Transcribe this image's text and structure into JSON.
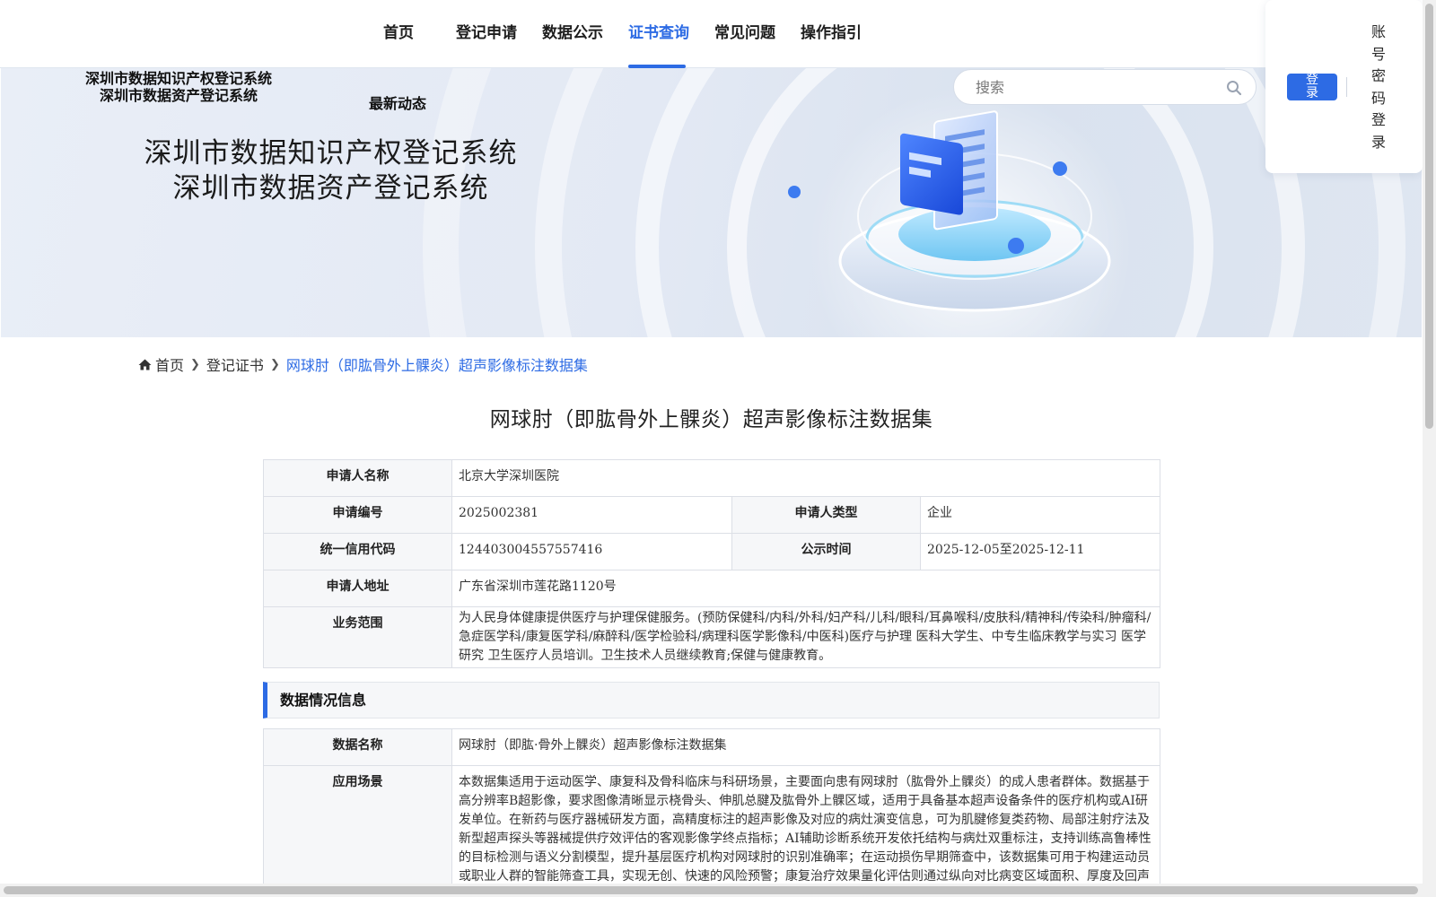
{
  "nav": {
    "items": [
      {
        "label": "首页",
        "active": false
      },
      {
        "label": "登记申请",
        "active": false
      },
      {
        "label": "数据公示",
        "active": false
      },
      {
        "label": "证书查询",
        "active": true
      },
      {
        "label": "常见问题",
        "active": false
      },
      {
        "label": "操作指引",
        "active": false
      }
    ]
  },
  "header": {
    "logo_line1": "深圳市数据知识产权登记系统",
    "logo_line2": "深圳市数据资产登记系统",
    "news_label": "最新动态",
    "banner_title_line1": "深圳市数据知识产权登记系统",
    "banner_title_line2": "深圳市数据资产登记系统"
  },
  "search": {
    "placeholder": "搜索",
    "icon": "search-icon"
  },
  "login": {
    "button_label": "登录",
    "password_login_label": "账号密码登录"
  },
  "breadcrumb": {
    "home": "首页",
    "level2": "登记证书",
    "current": "网球肘（即肱骨外上髁炎）超声影像标注数据集",
    "icon": "home-icon"
  },
  "page": {
    "title": "网球肘（即肱骨外上髁炎）超声影像标注数据集"
  },
  "applicant": {
    "name_label": "申请人名称",
    "name_value": "北京大学深圳医院",
    "number_label": "申请编号",
    "number_value": "2025002381",
    "type_label": "申请人类型",
    "type_value": "企业",
    "credit_label": "统一信用代码",
    "credit_value": "12440300455755741б",
    "publicity_label": "公示时间",
    "publicity_value": "2025-12-05至2025-12-11",
    "address_label": "申请人地址",
    "address_value": "广东省深圳市莲花路1120号",
    "scope_label": "业务范围",
    "scope_value": "为人民身体健康提供医疗与护理保健服务。(预防保健科/内科/外科/妇产科/儿科/眼科/耳鼻喉科/皮肤科/精神科/传染科/肿瘤科/急症医学科/康复医学科/麻醉科/医学检验科/病理科医学影像科/中医科)医疗与护理 医科大学生、中专生临床教学与实习 医学研究 卫生医疗人员培训。卫生技术人员继续教育;保健与健康教育。"
  },
  "data_section": {
    "heading": "数据情况信息",
    "name_label": "数据名称",
    "name_value": "网球肘（即肱·骨外上髁炎）超声影像标注数据集",
    "scenario_label": "应用场景",
    "scenario_value": "本数据集适用于运动医学、康复科及骨科临床与科研场景，主要面向患有网球肘（肱骨外上髁炎）的成人患者群体。数据基于高分辨率B超影像，要求图像清晰显示桡骨头、伸肌总腱及肱骨外上髁区域，适用于具备基本超声设备条件的医疗机构或AI研发单位。在新药与医疗器械研发方面，高精度标注的超声影像及对应的病灶演变信息，可为肌腱修复类药物、局部注射疗法及新型超声探头等器械提供疗效评估的客观影像学终点指标；AI辅助诊断系统开发依托结构与病灶双重标注，支持训练高鲁棒性的目标检测与语义分割模型，提升基层医疗机构对网球肘的识别准确率；在运动损伤早期筛查中，该数据集可用于构建运动员或职业人群的智能筛查工具，实现无创、快速的风险预警；康复治疗效果量化评估则通过纵向对比病变区域面积、厚度及回声特征变化，为物理治疗、冲击波疗法等康复手段提供客观依据。"
  },
  "colors": {
    "accent": "#2d6be4",
    "banner_bg": "#e3e9f4",
    "label_bg": "#f6f7f9"
  }
}
